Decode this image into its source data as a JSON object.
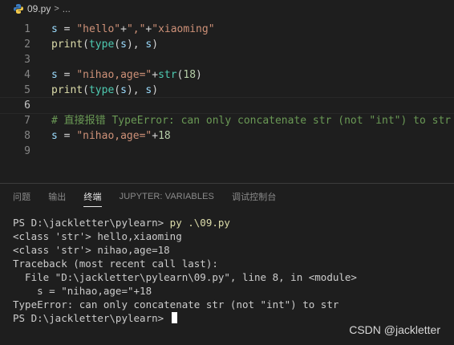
{
  "breadcrumb": {
    "file": "09.py",
    "separator": ">",
    "ellipsis": "..."
  },
  "editor": {
    "lines": [
      {
        "n": "1",
        "tokens": [
          [
            "var",
            "s"
          ],
          [
            "op",
            " = "
          ],
          [
            "str",
            "\"hello\""
          ],
          [
            "op",
            "+"
          ],
          [
            "str",
            "\",\""
          ],
          [
            "op",
            "+"
          ],
          [
            "str",
            "\"xiaoming\""
          ]
        ]
      },
      {
        "n": "2",
        "tokens": [
          [
            "fn",
            "print"
          ],
          [
            "op",
            "("
          ],
          [
            "cls",
            "type"
          ],
          [
            "op",
            "("
          ],
          [
            "var",
            "s"
          ],
          [
            "op",
            "), "
          ],
          [
            "var",
            "s"
          ],
          [
            "op",
            ")"
          ]
        ]
      },
      {
        "n": "3",
        "tokens": []
      },
      {
        "n": "4",
        "tokens": [
          [
            "var",
            "s"
          ],
          [
            "op",
            " = "
          ],
          [
            "str",
            "\"nihao,age=\""
          ],
          [
            "op",
            "+"
          ],
          [
            "cls",
            "str"
          ],
          [
            "op",
            "("
          ],
          [
            "num",
            "18"
          ],
          [
            "op",
            ")"
          ]
        ]
      },
      {
        "n": "5",
        "tokens": [
          [
            "fn",
            "print"
          ],
          [
            "op",
            "("
          ],
          [
            "cls",
            "type"
          ],
          [
            "op",
            "("
          ],
          [
            "var",
            "s"
          ],
          [
            "op",
            "), "
          ],
          [
            "var",
            "s"
          ],
          [
            "op",
            ")"
          ]
        ]
      },
      {
        "n": "6",
        "tokens": [],
        "current": true
      },
      {
        "n": "7",
        "tokens": [
          [
            "com",
            "# 直接报错 TypeError: can only concatenate str (not \"int\") to str"
          ]
        ]
      },
      {
        "n": "8",
        "tokens": [
          [
            "var",
            "s"
          ],
          [
            "op",
            " = "
          ],
          [
            "str",
            "\"nihao,age=\""
          ],
          [
            "op",
            "+"
          ],
          [
            "num",
            "18"
          ]
        ]
      },
      {
        "n": "9",
        "tokens": []
      }
    ]
  },
  "panel": {
    "tabs": [
      {
        "label": "问题",
        "active": false
      },
      {
        "label": "输出",
        "active": false
      },
      {
        "label": "终端",
        "active": true
      },
      {
        "label": "JUPYTER: VARIABLES",
        "active": false
      },
      {
        "label": "调试控制台",
        "active": false
      }
    ],
    "terminal": {
      "prompt1": "PS D:\\jackletter\\pylearn> ",
      "command": "py .\\09.py",
      "output": [
        "<class 'str'> hello,xiaoming",
        "<class 'str'> nihao,age=18",
        "Traceback (most recent call last):",
        "  File \"D:\\jackletter\\pylearn\\09.py\", line 8, in <module>",
        "    s = \"nihao,age=\"+18",
        "TypeError: can only concatenate str (not \"int\") to str"
      ],
      "prompt2": "PS D:\\jackletter\\pylearn> "
    }
  },
  "watermark": "CSDN @jackletter",
  "colors": {
    "background": "#1e1e1e",
    "string": "#ce9178",
    "keyword_fn": "#dcdcaa",
    "variable": "#9cdcfe",
    "comment": "#6a9955",
    "number": "#b5cea8",
    "builtin": "#4ec9b0"
  }
}
